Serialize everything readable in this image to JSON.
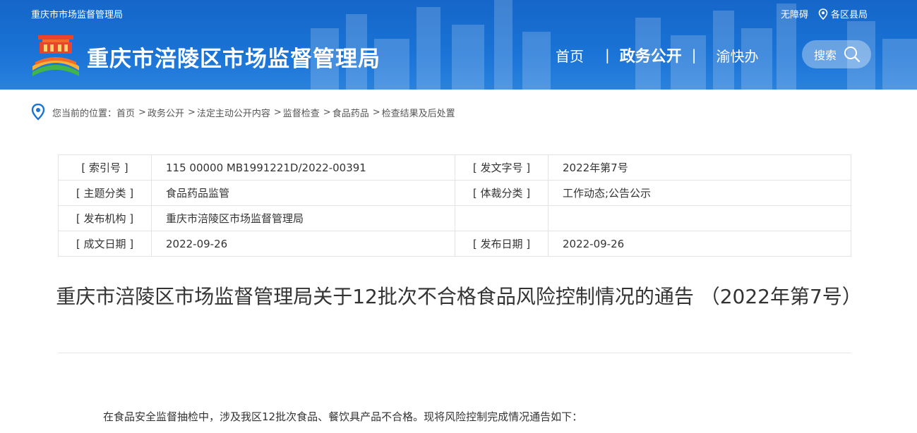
{
  "header": {
    "top_site_name": "重庆市市场监督管理局",
    "accessibility": "无障碍",
    "districts": "各区县局",
    "site_title": "重庆市涪陵区市场监督管理局",
    "nav": {
      "home": "首页",
      "gov_open": "政务公开",
      "yukuaiban": "渝快办"
    },
    "search_label": "搜索"
  },
  "breadcrumb": {
    "prefix": "您当前的位置：",
    "items": [
      "首页",
      "政务公开",
      "法定主动公开内容",
      "监督检查",
      "食品药品",
      "检查结果及后处置"
    ]
  },
  "meta": {
    "rows": [
      {
        "l1": "[ 索引号 ]",
        "v1": "115 00000 MB1991221D/2022-00391",
        "l2": "[ 发文字号 ]",
        "v2": "2022年第7号"
      },
      {
        "l1": "[ 主题分类 ]",
        "v1": "食品药品监管",
        "l2": "[ 体裁分类 ]",
        "v2": "工作动态;公告公示"
      },
      {
        "l1": "[ 发布机构 ]",
        "v1": "重庆市涪陵区市场监督管理局",
        "l2": "",
        "v2": ""
      },
      {
        "l1": "[ 成文日期 ]",
        "v1": "2022-09-26",
        "l2": "[ 发布日期 ]",
        "v2": "2022-09-26"
      }
    ]
  },
  "article": {
    "title": "重庆市涪陵区市场监督管理局关于12批次不合格食品风险控制情况的通告 （2022年第7号）",
    "first_paragraph": "在食品安全监督抽检中，涉及我区12批次食品、餐饮具产品不合格。现将风险控制完成情况通告如下："
  },
  "icons": {
    "location": "location-pin-icon",
    "search": "magnifier-icon"
  },
  "colors": {
    "header_blue": "#1a73d6",
    "breadcrumb_pin": "#1a73d6"
  }
}
